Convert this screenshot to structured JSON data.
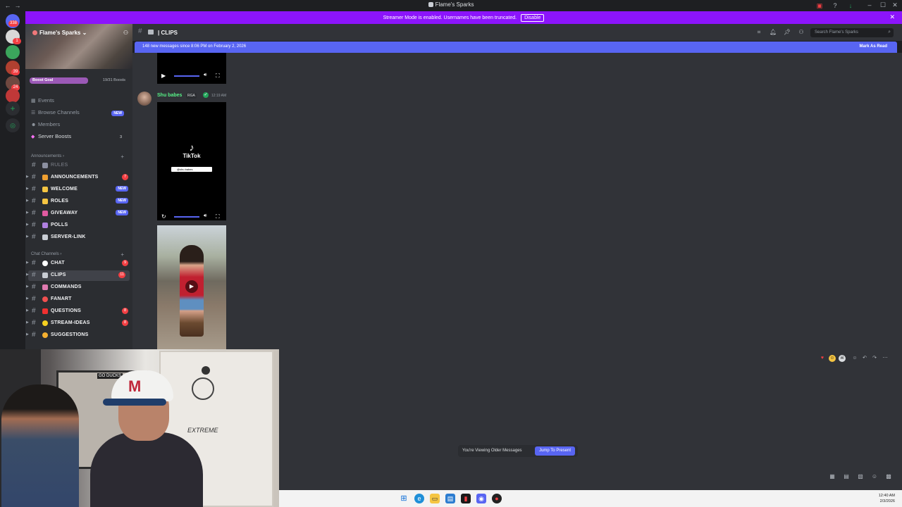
{
  "window": {
    "title": "Flame's Sparks"
  },
  "rail": {
    "servers": [
      {
        "badge": "338"
      },
      {
        "badge": "1"
      },
      {
        "badge": ""
      },
      {
        "badge": "39"
      },
      {
        "badge": "24"
      },
      {
        "badge": "10"
      }
    ],
    "add_icon": "+",
    "discover_icon": "compass-icon"
  },
  "streamer_banner": {
    "text": "Streamer Mode is enabled. Usernames have been truncated.",
    "button": "Disable",
    "close": "✕"
  },
  "server": {
    "name": "Flame's Sparks",
    "boost_goal_label": "Boost Goal",
    "boost_count": "19/31 Boosts",
    "boost_progress": 0.613
  },
  "menu": [
    {
      "label": "Events",
      "badge": ""
    },
    {
      "label": "Browse Channels",
      "badge": "NEW"
    },
    {
      "label": "Members",
      "badge": ""
    },
    {
      "label": "Server Boosts",
      "badge": "3"
    }
  ],
  "categories": {
    "announcements": "Announcements",
    "chat": "Chat Channels"
  },
  "channels": [
    {
      "name": "RULES",
      "badge": "",
      "muted": true,
      "color": "#8b8fa0"
    },
    {
      "name": "ANNOUNCEMENTS",
      "badge": "7",
      "color": "#f0a030"
    },
    {
      "name": "WELCOME",
      "badge": "NEW",
      "color": "#f5c542"
    },
    {
      "name": "ROLES",
      "badge": "NEW",
      "color": "#f5c542"
    },
    {
      "name": "GIVEAWAY",
      "badge": "NEW",
      "color": "#e05aa0"
    },
    {
      "name": "POLLS",
      "badge": "",
      "color": "#b080e0"
    },
    {
      "name": "SERVER-LINK",
      "badge": "",
      "color": "#c9cdd4"
    },
    {
      "name": "CHAT",
      "badge": "9",
      "color": "#ffffff"
    },
    {
      "name": "CLIPS",
      "badge": "11",
      "color": "#c9cdd4",
      "selected": true
    },
    {
      "name": "COMMANDS",
      "badge": "",
      "color": "#e07ab0"
    },
    {
      "name": "FANART",
      "badge": "",
      "color": "#f05050"
    },
    {
      "name": "QUESTIONS",
      "badge": "8",
      "color": "#f03030"
    },
    {
      "name": "STREAM-IDEAS",
      "badge": "8",
      "color": "#f5d020"
    },
    {
      "name": "SUGGESTIONS",
      "badge": "",
      "color": "#f5b030"
    }
  ],
  "header": {
    "channel_name": "| CLIPS",
    "search_placeholder": "Search Flame's Sparks"
  },
  "new_messages": {
    "text": "148 new messages since 8:06 PM on February 2, 2026",
    "mark_read": "Mark As Read"
  },
  "message": {
    "author": "Shu babes",
    "tag": "RGA",
    "time": "12:19 AM",
    "tiktok_word": "TikTok",
    "tiktok_handle": "@shu.babes"
  },
  "webcam": {
    "safe_label": "EXTREME",
    "sticker": "GO DUCKS"
  },
  "older_messages": {
    "text": "You're Viewing Older Messages",
    "jump": "Jump To Present"
  },
  "clock": {
    "time": "12:40 AM",
    "date": "2/3/2026"
  }
}
